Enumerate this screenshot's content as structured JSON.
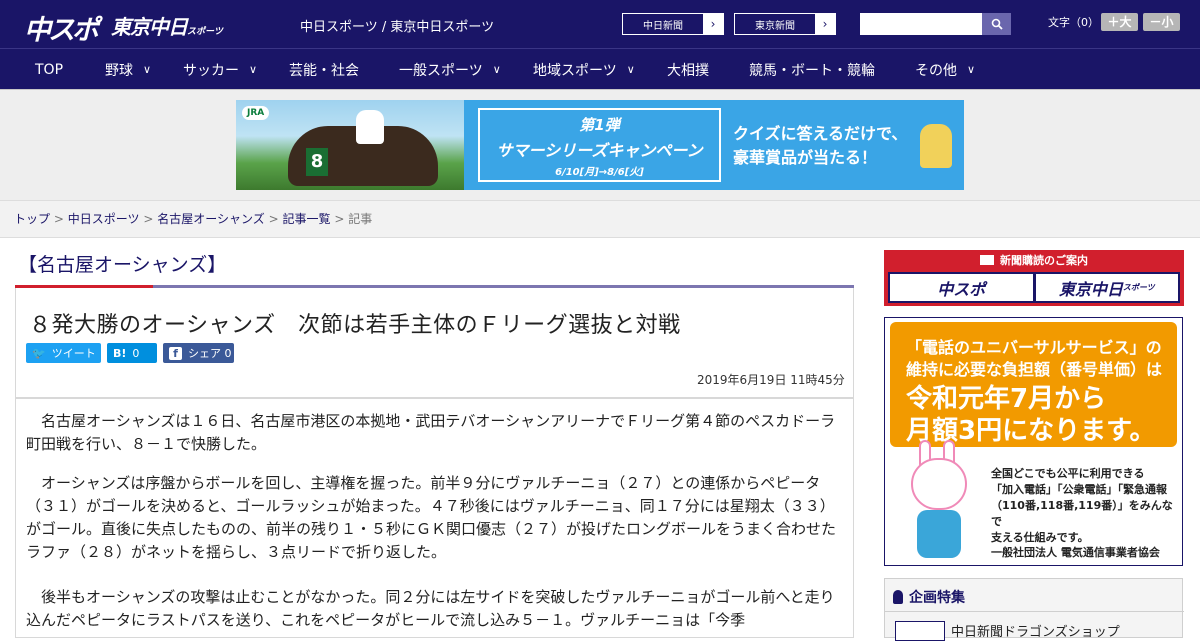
{
  "header": {
    "logo_chunichi": "中スポ",
    "logo_tokyo": "東京中日",
    "logo_tokyo_small": "スポーツ",
    "site_links": "中日スポーツ / 東京中日スポーツ",
    "ext_buttons": [
      {
        "label": "中日新聞",
        "icon": "chevron-right-icon"
      },
      {
        "label": "東京新聞",
        "icon": "chevron-right-icon"
      }
    ],
    "search_placeholder": "",
    "search_icon": "search-icon",
    "font_size_label": "文字（0）",
    "font_larger": "＋大",
    "font_smaller": "－小"
  },
  "nav": {
    "items": [
      {
        "label": "TOP",
        "has_menu": false
      },
      {
        "label": "野球",
        "has_menu": true
      },
      {
        "label": "サッカー",
        "has_menu": true
      },
      {
        "label": "芸能・社会",
        "has_menu": false
      },
      {
        "label": "一般スポーツ",
        "has_menu": true
      },
      {
        "label": "地域スポーツ",
        "has_menu": true
      },
      {
        "label": "大相撲",
        "has_menu": false
      },
      {
        "label": "競馬・ボート・競輪",
        "has_menu": false
      },
      {
        "label": "その他",
        "has_menu": true
      }
    ]
  },
  "ad_banner": {
    "jra": "JRA",
    "saddle_number": "8",
    "line1": "第1弾",
    "line2": "サマーシリーズキャンペーン",
    "line3": "6/10[月]→8/6[火]",
    "tag1": "クイズに答えるだけで、",
    "tag2": "豪華賞品が当たる！"
  },
  "breadcrumb": {
    "items": [
      "トップ",
      "中日スポーツ",
      "名古屋オーシャンズ",
      "記事一覧"
    ],
    "separator": ">",
    "current": "記事"
  },
  "article": {
    "category": "【名古屋オーシャンズ】",
    "headline": "８発大勝のオーシャンズ　次節は若手主体のＦリーグ選抜と対戦",
    "share": {
      "tweet": "ツイート",
      "hatena_count": "0",
      "hatena_icon": "B!",
      "facebook": "シェア",
      "facebook_count": "0"
    },
    "date": "2019年6月19日 11時45分",
    "paragraphs": [
      "　名古屋オーシャンズは１６日、名古屋市港区の本拠地・武田テバオーシャンアリーナでＦリーグ第４節のペスカドーラ町田戦を行い、８－１で快勝した。",
      "　オーシャンズは序盤からボールを回し、主導権を握った。前半９分にヴァルチーニョ（２７）との連係からペピータ（３１）がゴールを決めると、ゴールラッシュが始まった。４７秒後にはヴァルチーニョ、同１７分には星翔太（３３）がゴール。直後に失点したものの、前半の残り１・５秒にＧＫ関口優志（２７）が投げたロングボールをうまく合わせたラファ（２８）がネットを揺らし、３点リードで折り返した。",
      "　後半もオーシャンズの攻撃は止むことがなかった。同２分には左サイドを突破したヴァルチーニョがゴール前へと走り込んだペピータにラストパスを送り、これをペピータがヒールで流し込み５－１。ヴァルチーニョは「今季"
    ]
  },
  "sidebar": {
    "subscribe_title": "新聞購読のご案内",
    "subscribe_left": "中スポ",
    "subscribe_right": "東京中日",
    "subscribe_right_small": "スポーツ",
    "universal": {
      "l1": "「電話のユニバーサルサービス」の",
      "l2": "維持に必要な負担額（番号単価）は",
      "l3": "令和元年7月から",
      "l4": "月額3円になります。",
      "desc": [
        "全国どこでも公平に利用できる",
        "「加入電話」「公衆電話」「緊急通報",
        "（110番,118番,119番）」をみんなで",
        "支える仕組みです。"
      ],
      "org": "一般社団法人 電気通信事業者協会"
    },
    "feature_title": "企画特集",
    "feature_item": "中日新聞ドラゴンズショップ"
  },
  "colors": {
    "navy": "#1a1567",
    "accent_red": "#d11f2d",
    "twitter": "#1da1f2",
    "hatena": "#008fde",
    "facebook": "#3b5998",
    "orange": "#f29a00"
  }
}
